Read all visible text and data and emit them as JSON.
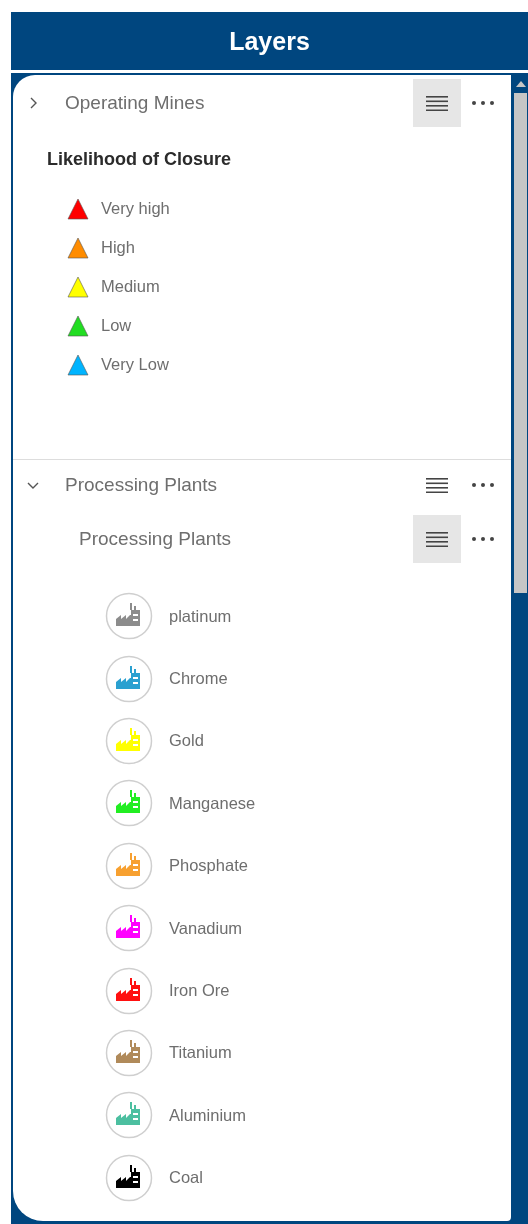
{
  "header": {
    "title": "Layers"
  },
  "layers": [
    {
      "title": "Operating Mines",
      "expanded": false,
      "legend_active": true,
      "legend_title": "Likelihood of Closure",
      "symbols": [
        {
          "kind": "triangle",
          "label": "Very high",
          "color": "#ff0000"
        },
        {
          "kind": "triangle",
          "label": "High",
          "color": "#ff8c00"
        },
        {
          "kind": "triangle",
          "label": "Medium",
          "color": "#ffff00"
        },
        {
          "kind": "triangle",
          "label": "Low",
          "color": "#22dd22"
        },
        {
          "kind": "triangle",
          "label": "Very Low",
          "color": "#00b4ff"
        }
      ]
    },
    {
      "title": "Processing Plants",
      "expanded": true,
      "legend_active": false,
      "sublayers": [
        {
          "title": "Processing Plants",
          "legend_active": true,
          "symbols": [
            {
              "kind": "factory",
              "label": "platinum",
              "color": "#8c8c8c"
            },
            {
              "kind": "factory",
              "label": "Chrome",
              "color": "#2aa0d0"
            },
            {
              "kind": "factory",
              "label": "Gold",
              "color": "#ffff00"
            },
            {
              "kind": "factory",
              "label": "Manganese",
              "color": "#22ee22"
            },
            {
              "kind": "factory",
              "label": "Phosphate",
              "color": "#f7a030"
            },
            {
              "kind": "factory",
              "label": "Vanadium",
              "color": "#ff00ff"
            },
            {
              "kind": "factory",
              "label": "Iron Ore",
              "color": "#ff1010"
            },
            {
              "kind": "factory",
              "label": "Titanium",
              "color": "#b08a5a"
            },
            {
              "kind": "factory",
              "label": "Aluminium",
              "color": "#4cbfa0"
            },
            {
              "kind": "factory",
              "label": "Coal",
              "color": "#000000"
            }
          ]
        }
      ]
    }
  ]
}
